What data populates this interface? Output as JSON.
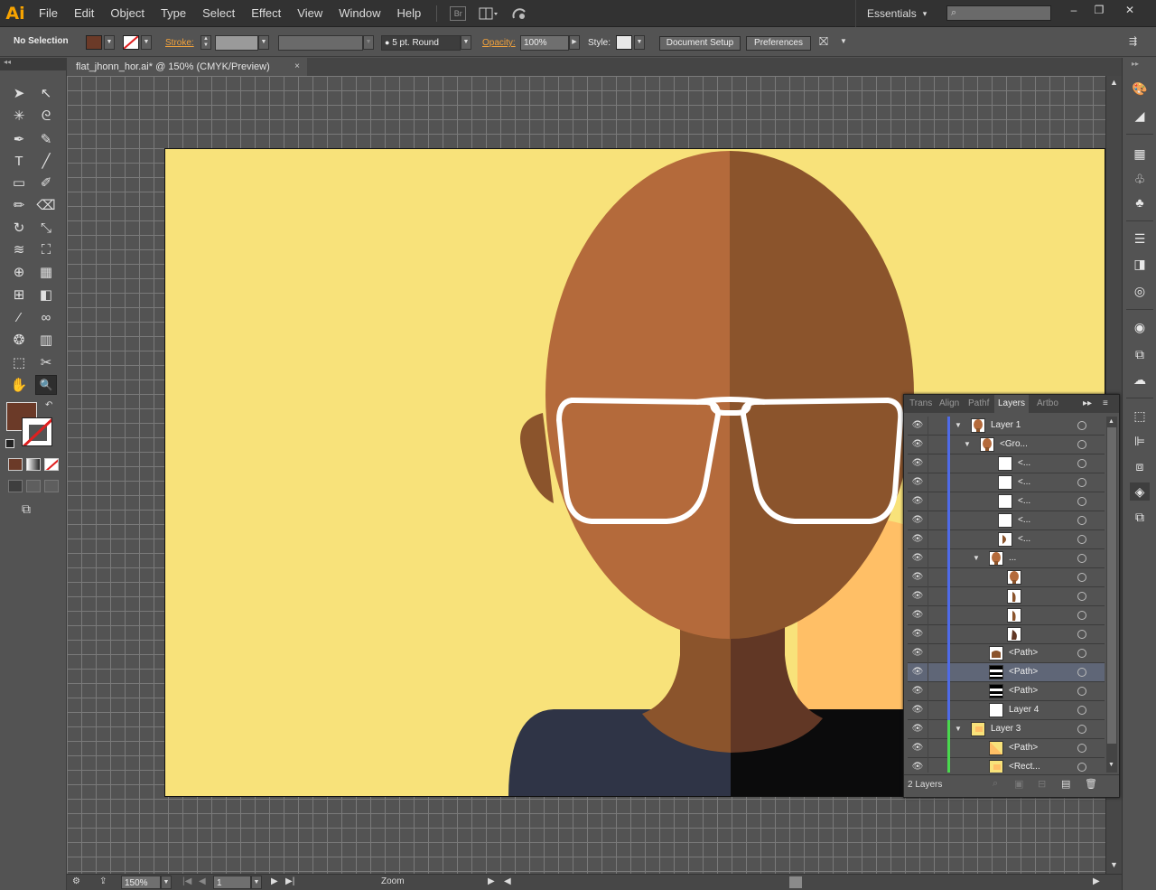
{
  "app": {
    "logo": "Ai"
  },
  "menu": [
    "File",
    "Edit",
    "Object",
    "Type",
    "Select",
    "Effect",
    "View",
    "Window",
    "Help"
  ],
  "menu_icons": {
    "bridge": "Br"
  },
  "workspace": {
    "label": "Essentials",
    "arrow": "▾"
  },
  "window_buttons": {
    "minimize": "–",
    "restore": "❐",
    "close": "✕"
  },
  "control": {
    "selection_label": "No Selection",
    "fill_color": "#6b3a28",
    "stroke_label": "Stroke:",
    "brush_value": "5 pt. Round",
    "opacity_label": "Opacity:",
    "opacity_value": "100%",
    "style_label": "Style:",
    "document_setup": "Document Setup",
    "preferences": "Preferences"
  },
  "document": {
    "tab_title": "flat_jhonn_hor.ai* @ 150% (CMYK/Preview)",
    "close": "×"
  },
  "status": {
    "zoom_value": "150%",
    "page_value": "1",
    "tool_label": "Zoom"
  },
  "artwork": {
    "background": "#f8e27a",
    "skin_light": "#b46a3b",
    "skin_dark": "#8b542c",
    "neck_light": "#8b542c",
    "neck_dark": "#613725",
    "shirt_left": "#2f3446",
    "shirt_right": "#0b0b0c",
    "side_shape": "#ffbf66",
    "glasses": "#ffffff"
  },
  "layers_panel": {
    "tabs": [
      "Trans",
      "Align",
      "Pathf",
      "Layers",
      "Artbo"
    ],
    "active_tab": "Layers",
    "footer_count": "2 Layers",
    "rows": [
      {
        "name": "Layer 1",
        "indent": 0,
        "twist": "▼",
        "color": "#4f6be8",
        "thumb": "head"
      },
      {
        "name": "<Gro...",
        "indent": 1,
        "twist": "▼",
        "color": "#4f6be8",
        "thumb": "head"
      },
      {
        "name": "<...",
        "indent": 3,
        "twist": "",
        "color": "#4f6be8",
        "thumb": "white"
      },
      {
        "name": "<...",
        "indent": 3,
        "twist": "",
        "color": "#4f6be8",
        "thumb": "white"
      },
      {
        "name": "<...",
        "indent": 3,
        "twist": "",
        "color": "#4f6be8",
        "thumb": "white"
      },
      {
        "name": "<...",
        "indent": 3,
        "twist": "",
        "color": "#4f6be8",
        "thumb": "white"
      },
      {
        "name": "<...",
        "indent": 3,
        "twist": "",
        "color": "#4f6be8",
        "thumb": "half"
      },
      {
        "name": "...",
        "indent": 2,
        "twist": "▼",
        "color": "#4f6be8",
        "thumb": "head"
      },
      {
        "name": "",
        "indent": 4,
        "twist": "",
        "color": "#4f6be8",
        "thumb": "head"
      },
      {
        "name": "",
        "indent": 4,
        "twist": "",
        "color": "#4f6be8",
        "thumb": "ear"
      },
      {
        "name": "",
        "indent": 4,
        "twist": "",
        "color": "#4f6be8",
        "thumb": "ear"
      },
      {
        "name": "",
        "indent": 4,
        "twist": "",
        "color": "#4f6be8",
        "thumb": "ear2"
      },
      {
        "name": "<Path>",
        "indent": 2,
        "twist": "",
        "color": "#4f6be8",
        "thumb": "neck"
      },
      {
        "name": "<Path>",
        "indent": 2,
        "twist": "",
        "color": "#4f6be8",
        "thumb": "stripes",
        "selected": true
      },
      {
        "name": "<Path>",
        "indent": 2,
        "twist": "",
        "color": "#4f6be8",
        "thumb": "stripes"
      },
      {
        "name": "Layer 4",
        "indent": 2,
        "twist": "",
        "color": "#4f6be8",
        "thumb": "white"
      },
      {
        "name": "Layer 3",
        "indent": 0,
        "twist": "▼",
        "color": "#49d84e",
        "thumb": "yellow"
      },
      {
        "name": "<Path>",
        "indent": 2,
        "twist": "",
        "color": "#49d84e",
        "thumb": "diag"
      },
      {
        "name": "<Rect...",
        "indent": 2,
        "twist": "",
        "color": "#49d84e",
        "thumb": "yellow"
      }
    ]
  },
  "toolbar_icons": {
    "selection": "➤",
    "direct_selection": "↖",
    "magic_wand": "✳",
    "lasso": "ᘓ",
    "pen": "✒",
    "curvature": "✎",
    "type": "T",
    "line": "╱",
    "rectangle": "▭",
    "paintbrush": "✐",
    "pencil": "✏",
    "eraser": "⌫",
    "rotate": "↻",
    "scale": "⤡",
    "warp": "≋",
    "free_transform": "⛶",
    "shape_builder": "⊕",
    "perspective": "▦",
    "mesh": "⊞",
    "gradient": "◧",
    "eyedropper": "⁄",
    "blend": "∞",
    "symbol_sprayer": "❂",
    "graph": "▥",
    "artboard": "⬚",
    "slice": "✂",
    "hand": "✋",
    "zoom": "🔍"
  }
}
